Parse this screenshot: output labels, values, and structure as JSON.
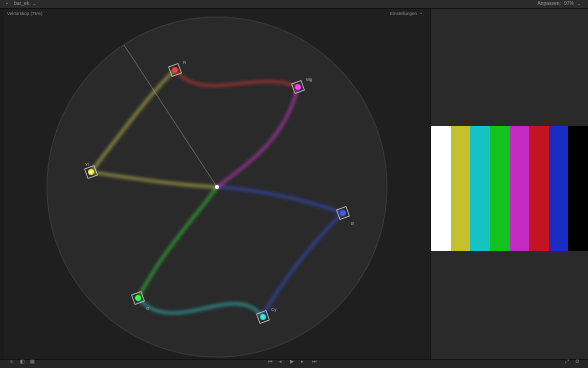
{
  "titlebar": {
    "clip_name": "bar_ek",
    "menu_glyph": "⌄",
    "viewer_label": "Anpassen:",
    "zoom": "97%",
    "zoom_glyph": "⌄",
    "icons": [
      "chevron-down-icon",
      "window-icon"
    ]
  },
  "scope": {
    "title": "Vektorskop",
    "subtitle": "(75%)",
    "settings_label": "Einstellungen",
    "settings_glyph": "⌄",
    "targets": [
      {
        "label": "R",
        "color": "#ff3a3a"
      },
      {
        "label": "Mg",
        "color": "#ff40ff"
      },
      {
        "label": "B",
        "color": "#3a5bff"
      },
      {
        "label": "Cy",
        "color": "#2ee8e0"
      },
      {
        "label": "G",
        "color": "#3aff3a"
      },
      {
        "label": "Yl",
        "color": "#f6f05a"
      }
    ]
  },
  "bars": {
    "colors": [
      "#ffffff",
      "#c6c12a",
      "#17c2c2",
      "#14c21e",
      "#c22ac2",
      "#c2151f",
      "#1b2cc2",
      "#000000"
    ]
  },
  "bottombar": {
    "left_icons": [
      "menu-icon",
      "split-icon",
      "grid-icon"
    ],
    "center_icons": [
      "skip-back-icon",
      "step-back-icon",
      "play-icon",
      "step-forward-icon",
      "skip-forward-icon"
    ],
    "right_icons": [
      "fullscreen-icon",
      "settings-icon"
    ],
    "glyphs": {
      "menu": "≡",
      "split": "◧",
      "grid": "▦",
      "skip_back": "⏮",
      "step_back": "◂",
      "play": "▶",
      "step_forward": "▸",
      "skip_forward": "⏭",
      "fullscreen": "⤢",
      "settings": "⚙"
    }
  }
}
